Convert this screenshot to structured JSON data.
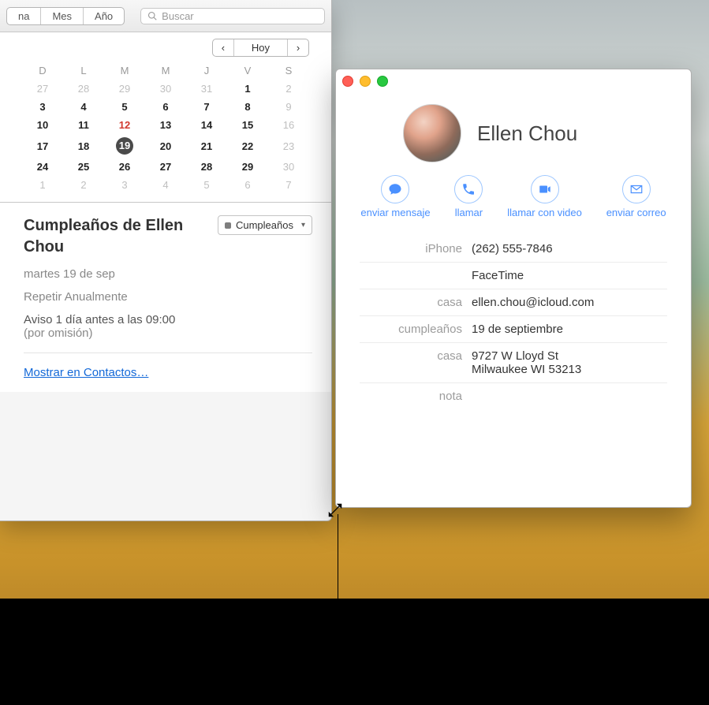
{
  "calendar": {
    "view_tabs": [
      "na",
      "Mes",
      "Año"
    ],
    "search_placeholder": "Buscar",
    "nav": {
      "prev": "‹",
      "today": "Hoy",
      "next": "›"
    },
    "day_headers": [
      "D",
      "L",
      "M",
      "M",
      "J",
      "V",
      "S"
    ],
    "weeks": [
      [
        {
          "n": "27",
          "s": "out"
        },
        {
          "n": "28",
          "s": "out"
        },
        {
          "n": "29",
          "s": "out"
        },
        {
          "n": "30",
          "s": "out"
        },
        {
          "n": "31",
          "s": "out"
        },
        {
          "n": "1",
          "s": "in"
        },
        {
          "n": "2",
          "s": "out"
        }
      ],
      [
        {
          "n": "3",
          "s": "in"
        },
        {
          "n": "4",
          "s": "in"
        },
        {
          "n": "5",
          "s": "in"
        },
        {
          "n": "6",
          "s": "in"
        },
        {
          "n": "7",
          "s": "in"
        },
        {
          "n": "8",
          "s": "in"
        },
        {
          "n": "9",
          "s": "out"
        }
      ],
      [
        {
          "n": "10",
          "s": "in"
        },
        {
          "n": "11",
          "s": "in"
        },
        {
          "n": "12",
          "s": "red"
        },
        {
          "n": "13",
          "s": "in"
        },
        {
          "n": "14",
          "s": "in"
        },
        {
          "n": "15",
          "s": "in"
        },
        {
          "n": "16",
          "s": "out"
        }
      ],
      [
        {
          "n": "17",
          "s": "in"
        },
        {
          "n": "18",
          "s": "in"
        },
        {
          "n": "19",
          "s": "sel"
        },
        {
          "n": "20",
          "s": "in"
        },
        {
          "n": "21",
          "s": "in"
        },
        {
          "n": "22",
          "s": "in"
        },
        {
          "n": "23",
          "s": "out"
        }
      ],
      [
        {
          "n": "24",
          "s": "in"
        },
        {
          "n": "25",
          "s": "in"
        },
        {
          "n": "26",
          "s": "in"
        },
        {
          "n": "27",
          "s": "in"
        },
        {
          "n": "28",
          "s": "in"
        },
        {
          "n": "29",
          "s": "in"
        },
        {
          "n": "30",
          "s": "out"
        }
      ],
      [
        {
          "n": "1",
          "s": "out"
        },
        {
          "n": "2",
          "s": "out"
        },
        {
          "n": "3",
          "s": "out"
        },
        {
          "n": "4",
          "s": "out"
        },
        {
          "n": "5",
          "s": "out"
        },
        {
          "n": "6",
          "s": "out"
        },
        {
          "n": "7",
          "s": "out"
        }
      ]
    ],
    "event": {
      "title": "Cumpleaños de Ellen Chou",
      "calendar_selector": "Cumpleaños",
      "date_line": "martes 19 de sep",
      "repeat_line": "Repetir Anualmente",
      "alert_line": "Aviso 1 día antes a las 09:00",
      "alert_sub": "(por omisión)",
      "show_contacts": "Mostrar en Contactos…"
    }
  },
  "contact": {
    "name": "Ellen Chou",
    "actions": {
      "message": "enviar mensaje",
      "call": "llamar",
      "video": "llamar con video",
      "mail": "enviar correo"
    },
    "rows": {
      "phone_label": "iPhone",
      "phone_value": "(262) 555-7846",
      "facetime_label": "",
      "facetime_value": "FaceTime",
      "email_label": "casa",
      "email_value": "ellen.chou@icloud.com",
      "birthday_label": "cumpleaños",
      "birthday_value": "19 de septiembre",
      "address_label": "casa",
      "address_value1": "9727 W Lloyd St",
      "address_value2": "Milwaukee WI 53213",
      "note_label": "nota",
      "note_value": ""
    }
  }
}
